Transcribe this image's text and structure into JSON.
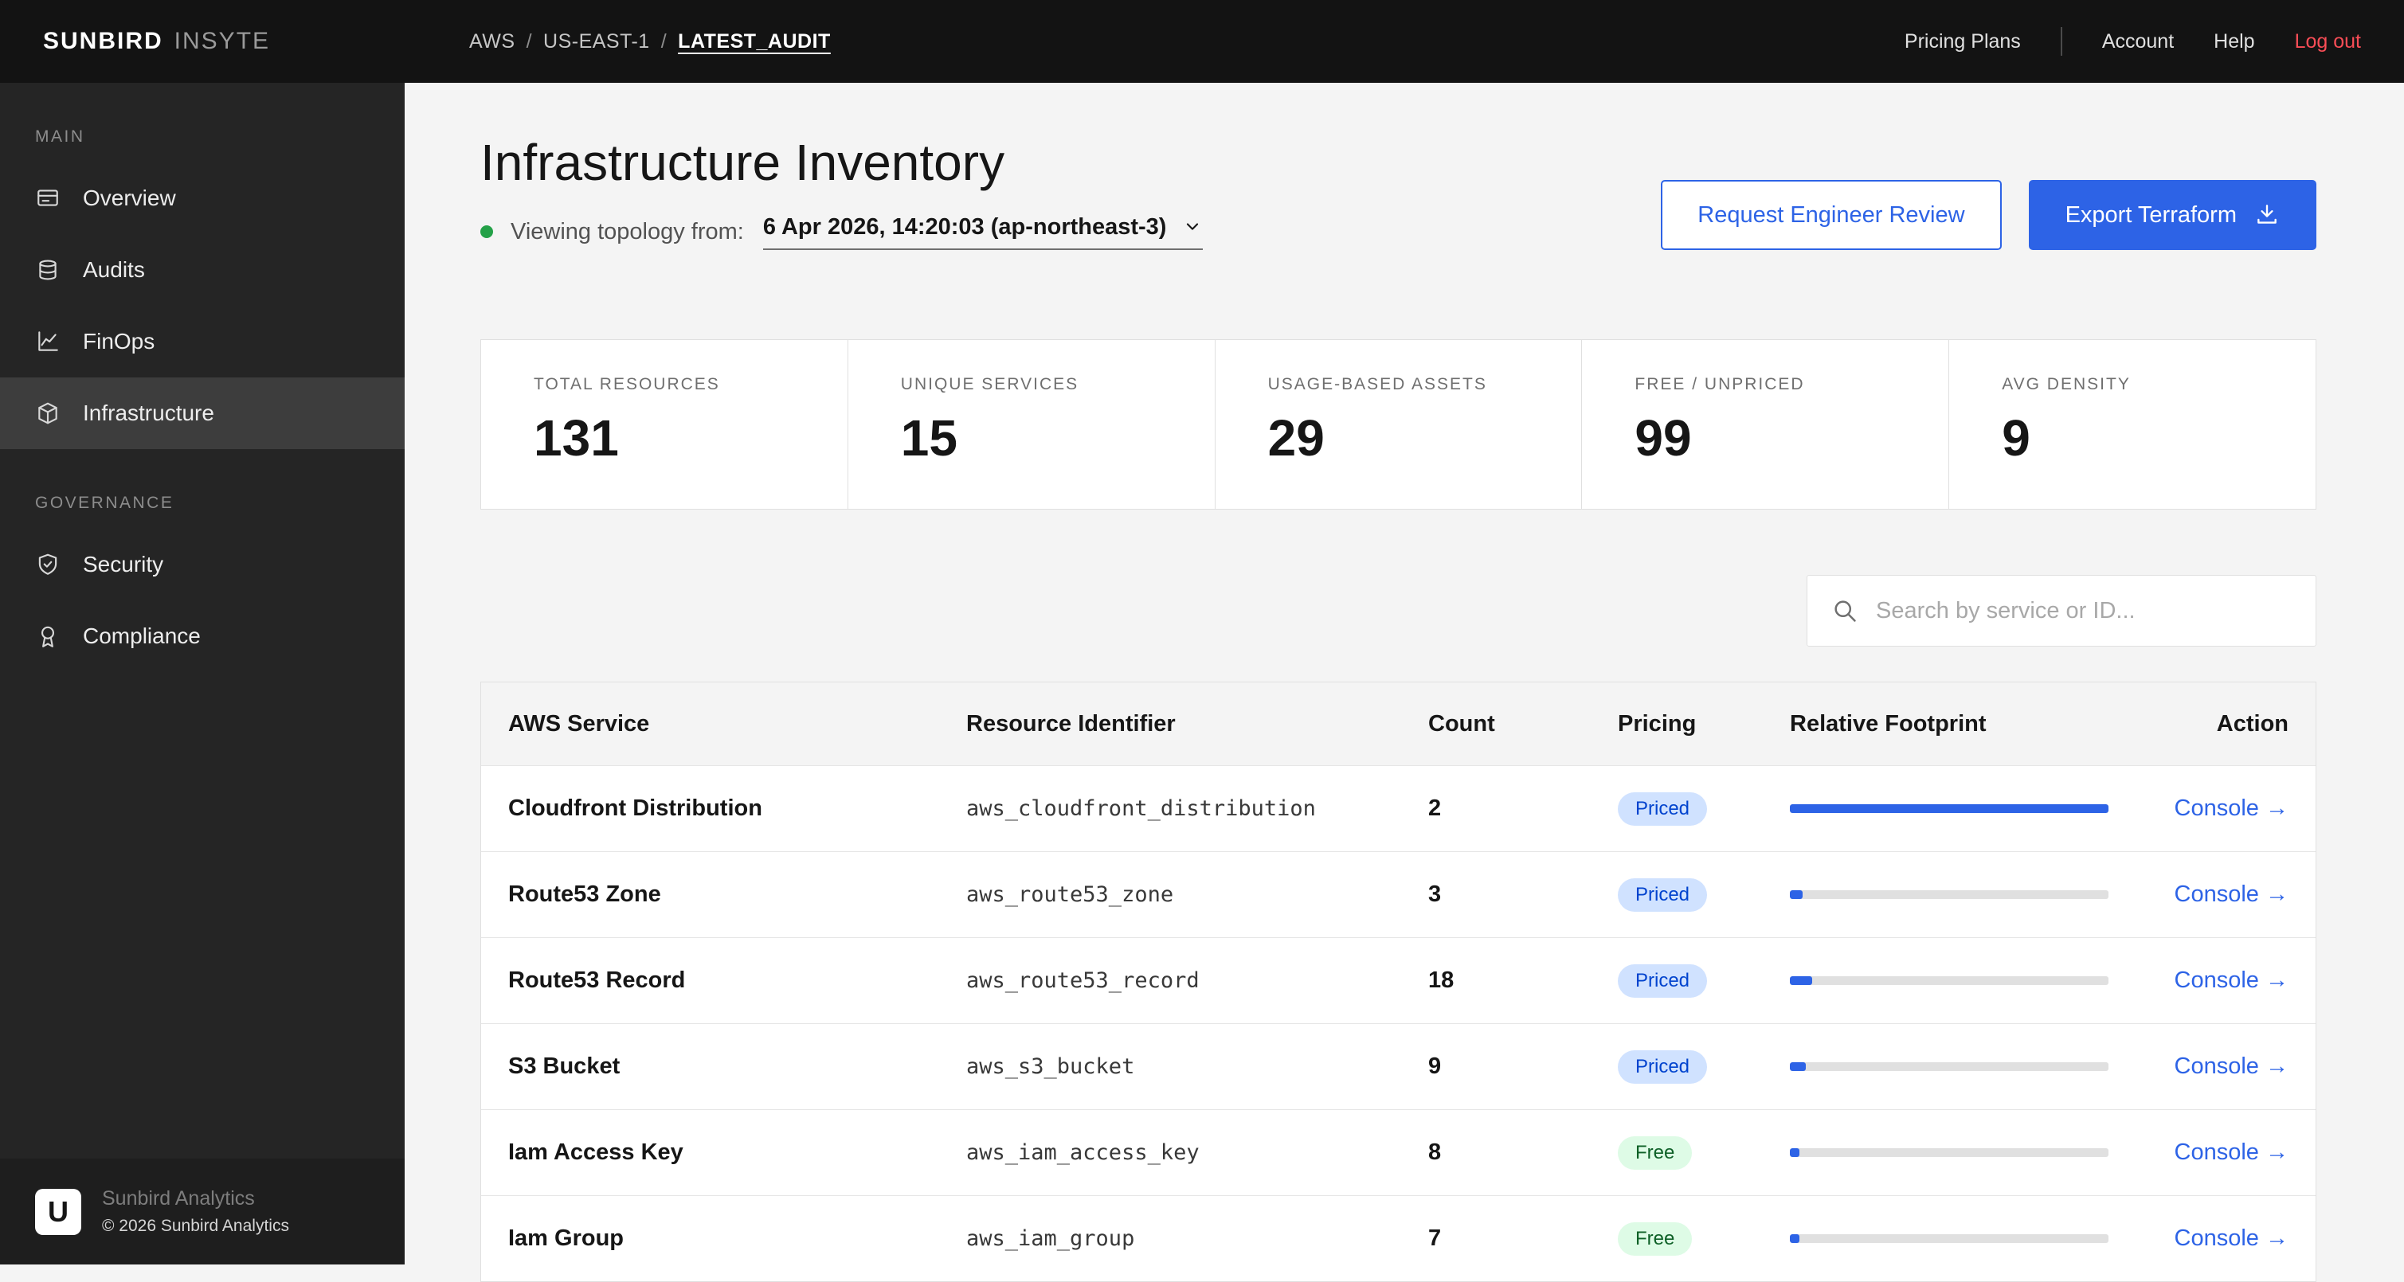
{
  "colors": {
    "accent": "#2d63e6",
    "logout": "#fa4d56",
    "status_green": "#24a148",
    "pill_priced_bg": "#d0e2ff",
    "pill_priced_text": "#0043ce",
    "pill_free_bg": "#defbe6",
    "pill_free_text": "#0e6027"
  },
  "brand": {
    "bold": "SUNBIRD",
    "light": "INSYTE"
  },
  "header": {
    "breadcrumb": {
      "parts": [
        "AWS",
        "US-EAST-1",
        "LATEST_AUDIT"
      ],
      "separator": "/"
    },
    "nav": [
      "Pricing Plans",
      "Account",
      "Help",
      "Log out"
    ]
  },
  "sidebar": {
    "sections": [
      {
        "label": "MAIN",
        "items": [
          {
            "label": "Overview"
          },
          {
            "label": "Audits"
          },
          {
            "label": "FinOps"
          },
          {
            "label": "Infrastructure",
            "state": "active"
          }
        ]
      },
      {
        "label": "GOVERNANCE",
        "items": [
          {
            "label": "Security"
          },
          {
            "label": "Compliance"
          }
        ]
      }
    ],
    "footer": {
      "logo_letter": "U",
      "name": "Sunbird Analytics",
      "copyright": "© 2026 Sunbird Analytics"
    }
  },
  "page": {
    "title": "Infrastructure Inventory"
  },
  "topology": {
    "label": "Viewing topology from:",
    "value": "6 Apr 2026, 14:20:03 (ap-northeast-3)"
  },
  "actions": {
    "review": "Request Engineer Review",
    "export": "Export Terraform"
  },
  "stats": [
    {
      "label": "TOTAL RESOURCES",
      "value": "131"
    },
    {
      "label": "UNIQUE SERVICES",
      "value": "15"
    },
    {
      "label": "USAGE-BASED ASSETS",
      "value": "29"
    },
    {
      "label": "FREE / UNPRICED",
      "value": "99"
    },
    {
      "label": "AVG DENSITY",
      "value": "9"
    }
  ],
  "search": {
    "placeholder": "Search by service or ID..."
  },
  "table": {
    "headers": [
      "AWS Service",
      "Resource Identifier",
      "Count",
      "Pricing",
      "Relative Footprint",
      "Action"
    ],
    "rows": [
      {
        "service": "Cloudfront Distribution",
        "identifier": "aws_cloudfront_distribution",
        "count": "2",
        "pricing_label": "Priced",
        "pricing_type": "priced",
        "footprint_pct": 100,
        "action": "Console →"
      },
      {
        "service": "Route53 Zone",
        "identifier": "aws_route53_zone",
        "count": "3",
        "pricing_label": "Priced",
        "pricing_type": "priced",
        "footprint_pct": 4,
        "action": "Console →"
      },
      {
        "service": "Route53 Record",
        "identifier": "aws_route53_record",
        "count": "18",
        "pricing_label": "Priced",
        "pricing_type": "priced",
        "footprint_pct": 7,
        "action": "Console →"
      },
      {
        "service": "S3 Bucket",
        "identifier": "aws_s3_bucket",
        "count": "9",
        "pricing_label": "Priced",
        "pricing_type": "priced",
        "footprint_pct": 5,
        "action": "Console →"
      },
      {
        "service": "Iam Access Key",
        "identifier": "aws_iam_access_key",
        "count": "8",
        "pricing_label": "Free",
        "pricing_type": "free",
        "footprint_pct": 3,
        "action": "Console →"
      },
      {
        "service": "Iam Group",
        "identifier": "aws_iam_group",
        "count": "7",
        "pricing_label": "Free",
        "pricing_type": "free",
        "footprint_pct": 3,
        "action": "Console →"
      }
    ]
  }
}
